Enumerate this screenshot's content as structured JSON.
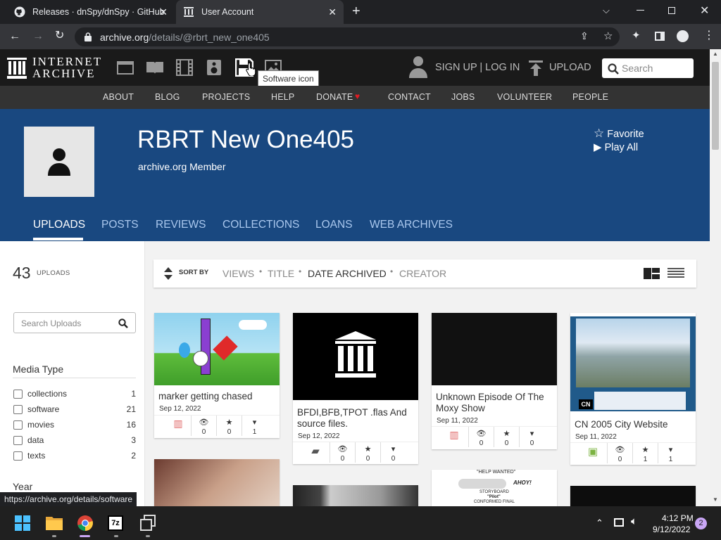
{
  "browser": {
    "tabs": [
      {
        "title": "Releases · dnSpy/dnSpy · GitHub"
      },
      {
        "title": "User Account"
      }
    ],
    "url_domain": "archive.org",
    "url_path": "/details/@rbrt_new_one405",
    "status_url": "https://archive.org/details/software"
  },
  "ia": {
    "logo_line1": "INTERNET",
    "logo_line2": "ARCHIVE",
    "tooltip": "Software icon",
    "signup_login": "SIGN UP | LOG IN",
    "upload": "UPLOAD",
    "search_placeholder": "Search",
    "nav": [
      "ABOUT",
      "BLOG",
      "PROJECTS",
      "HELP",
      "DONATE",
      "CONTACT",
      "JOBS",
      "VOLUNTEER",
      "PEOPLE"
    ]
  },
  "profile": {
    "name": "RBRT New One405",
    "subtitle": "archive.org Member",
    "favorite": "Favorite",
    "play_all": "Play All",
    "tabs": [
      "UPLOADS",
      "POSTS",
      "REVIEWS",
      "COLLECTIONS",
      "LOANS",
      "WEB ARCHIVES"
    ]
  },
  "sidebar": {
    "count": "43",
    "count_label": "UPLOADS",
    "search_placeholder": "Search Uploads",
    "media_type_heading": "Media Type",
    "media_types": [
      {
        "label": "collections",
        "count": "1"
      },
      {
        "label": "software",
        "count": "21"
      },
      {
        "label": "movies",
        "count": "16"
      },
      {
        "label": "data",
        "count": "3"
      },
      {
        "label": "texts",
        "count": "2"
      }
    ],
    "year_heading": "Year"
  },
  "sortbar": {
    "label": "SORT BY",
    "options": [
      "VIEWS",
      "TITLE",
      "DATE ARCHIVED",
      "CREATOR"
    ],
    "active": "DATE ARCHIVED"
  },
  "items": [
    {
      "title": "marker getting chased",
      "date": "Sep 12, 2022",
      "views": "0",
      "favorites": "0",
      "reviews": "1",
      "type": "movies"
    },
    {
      "title": "BFDI,BFB,TPOT .flas And source files.",
      "date": "Sep 12, 2022",
      "views": "0",
      "favorites": "0",
      "reviews": "0",
      "type": "collection"
    },
    {
      "title": "Unknown Episode Of The Moxy Show",
      "date": "Sep 11, 2022",
      "views": "0",
      "favorites": "0",
      "reviews": "0",
      "type": "movies"
    },
    {
      "title": "CN 2005 City Website",
      "date": "Sep 11, 2022",
      "views": "0",
      "favorites": "1",
      "reviews": "1",
      "type": "software",
      "thumb_badge": "CN"
    }
  ],
  "storyboard_snippet": {
    "line1": "\"HELP WANTED\"",
    "line2": "AHOY!",
    "line3": "STORYBOARD",
    "line4": "\"Pilot\"",
    "line5": "CONFORMED FINAL"
  },
  "taskbar": {
    "time": "4:12 PM",
    "date": "9/12/2022",
    "notifications": "2",
    "apps": [
      "windows-start",
      "file-explorer",
      "chrome",
      "7zip",
      "task-view"
    ]
  },
  "colors": {
    "banner": "#194880",
    "ia_top": "#1a1a1a",
    "ia_nav": "#333333",
    "heart": "#e31b23",
    "movies_icon": "#e06767",
    "software_icon": "#7cb342"
  }
}
